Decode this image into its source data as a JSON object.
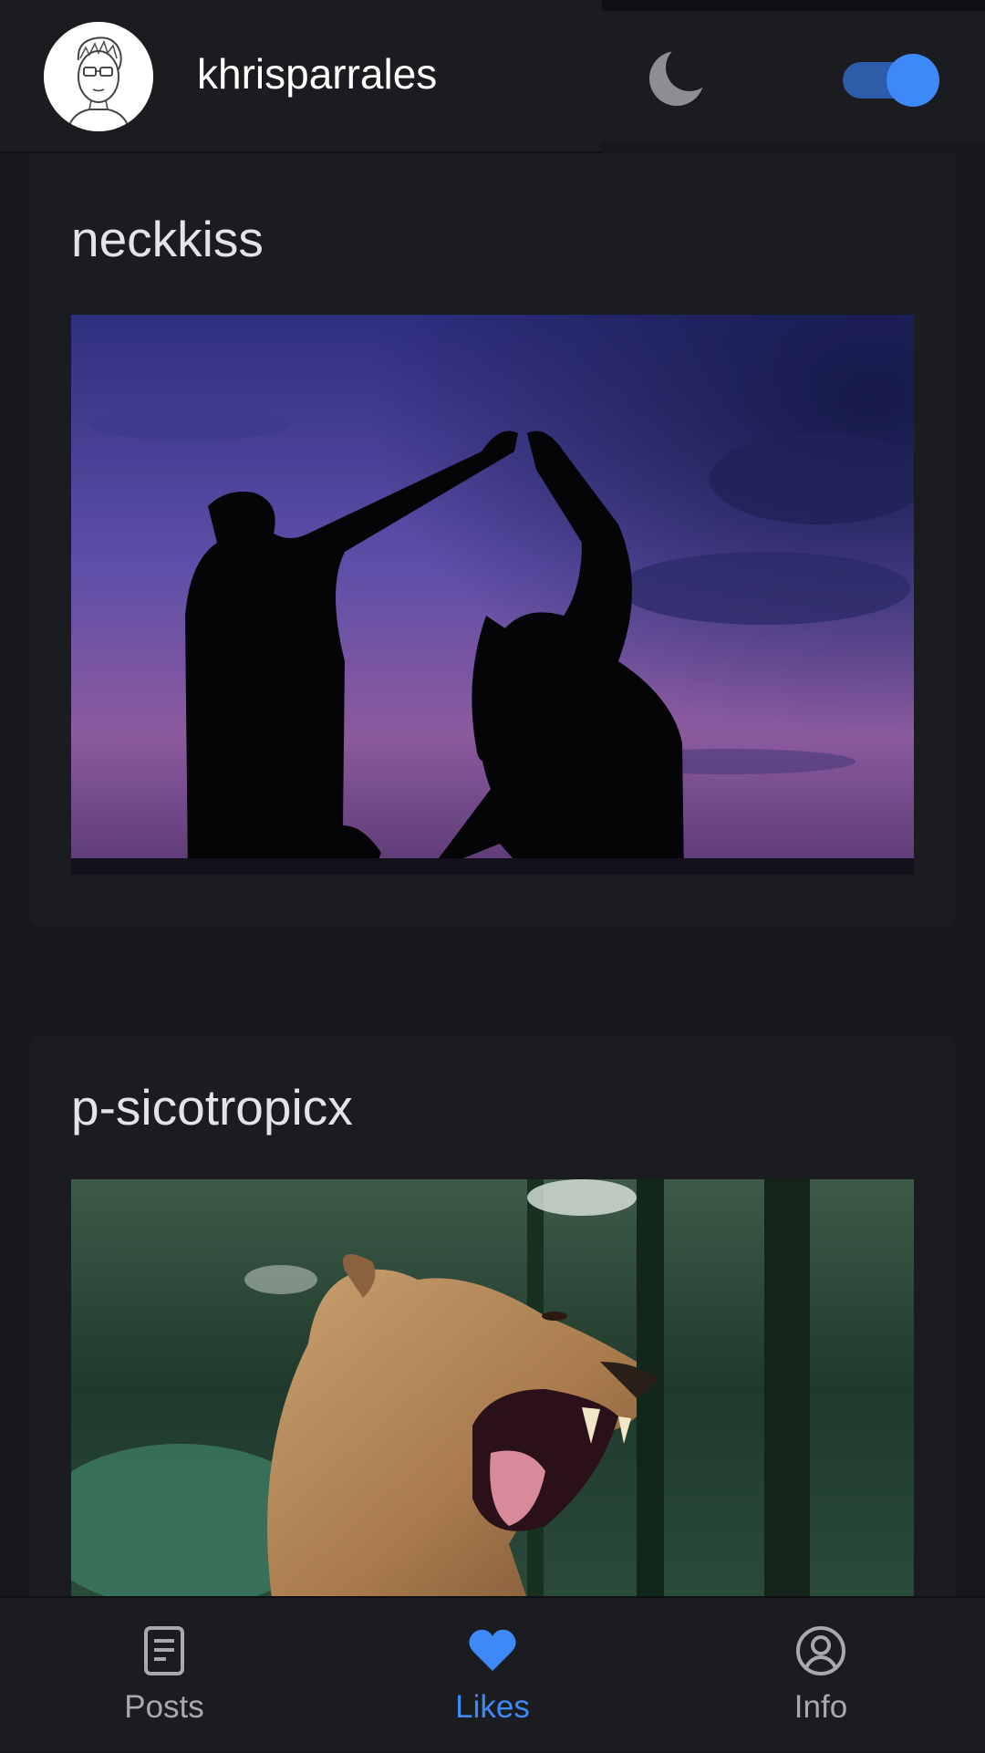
{
  "header": {
    "username": "khrisparrales",
    "dark_mode_enabled": true,
    "accent_color": "#3d8af7"
  },
  "feed": {
    "posts": [
      {
        "author": "neckkiss",
        "image": "silhouette-couple-dancing-purple-sky"
      },
      {
        "author": "p-sicotropicx",
        "image": "lioness-roaring-forest"
      }
    ]
  },
  "bottom_nav": {
    "items": [
      {
        "label": "Posts",
        "icon": "document-icon",
        "active": false
      },
      {
        "label": "Likes",
        "icon": "heart-icon",
        "active": true
      },
      {
        "label": "Info",
        "icon": "user-circle-icon",
        "active": false
      }
    ]
  }
}
